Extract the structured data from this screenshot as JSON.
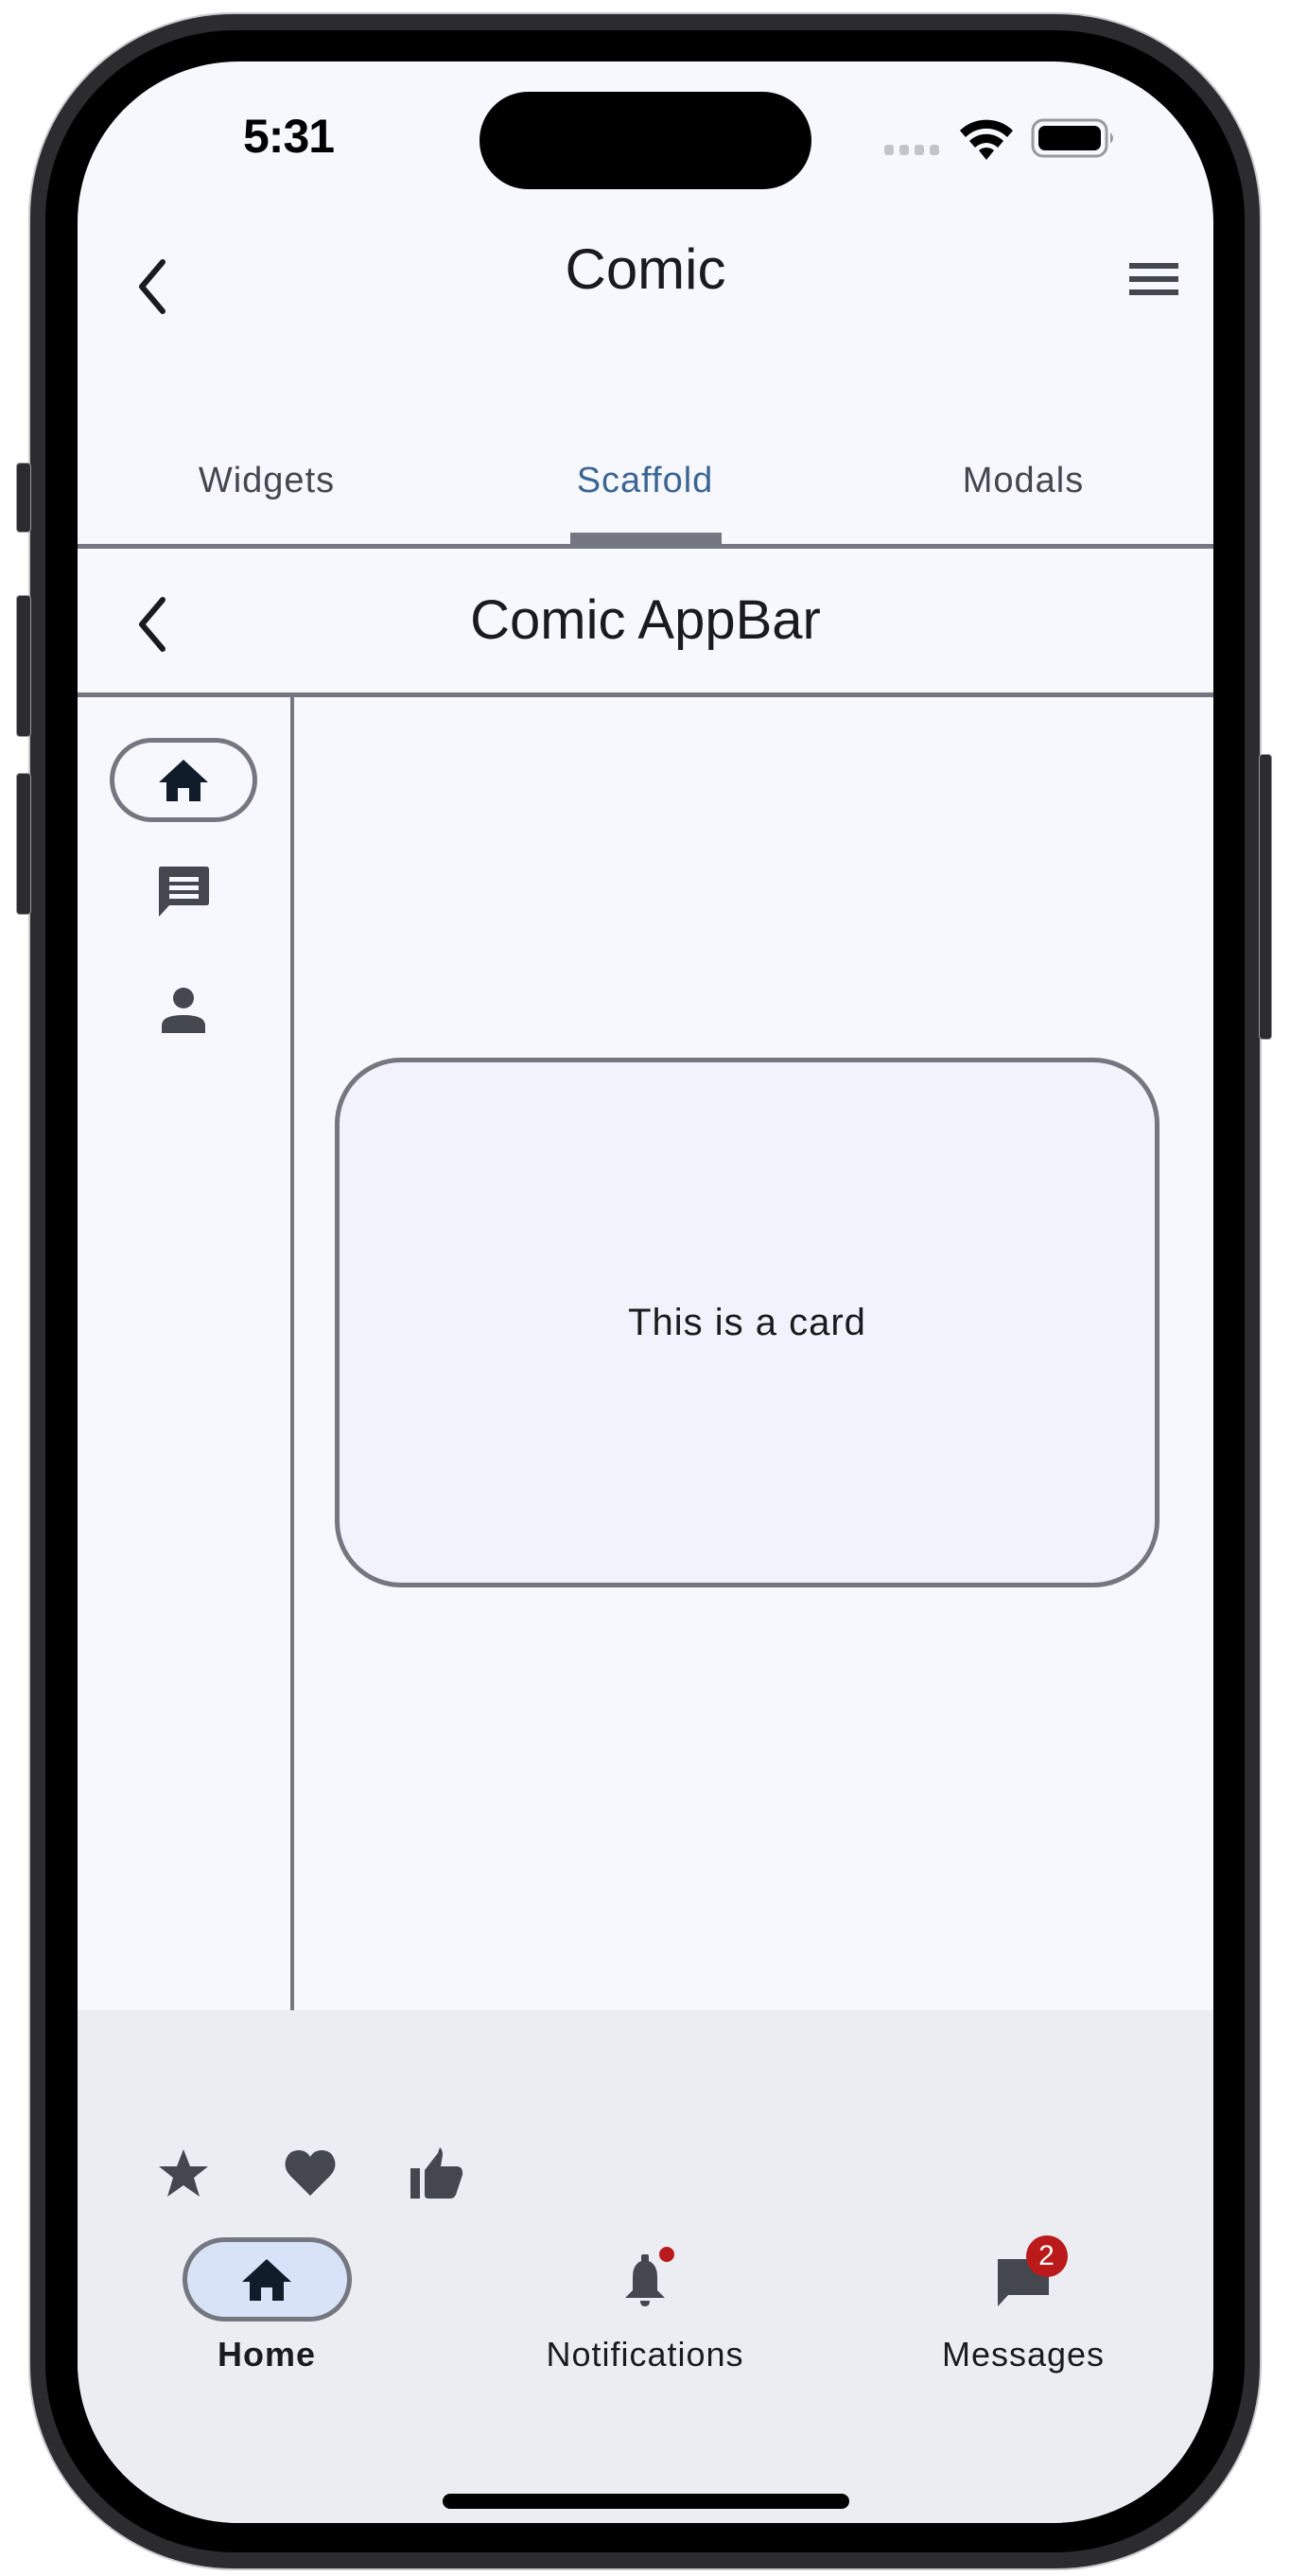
{
  "status_bar": {
    "time": "5:31",
    "icons": [
      "signal-dots-icon",
      "wifi-icon",
      "battery-icon"
    ]
  },
  "app_bar": {
    "title": "Comic",
    "back_icon": "chevron-left-icon",
    "menu_icon": "hamburger-menu-icon"
  },
  "tabs": [
    {
      "label": "Widgets",
      "active": false
    },
    {
      "label": "Scaffold",
      "active": true
    },
    {
      "label": "Modals",
      "active": false
    }
  ],
  "inner_app_bar": {
    "title": "Comic AppBar",
    "back_icon": "chevron-left-icon"
  },
  "navigation_rail": {
    "items": [
      {
        "icon": "home-icon",
        "active": true
      },
      {
        "icon": "chat-icon",
        "active": false
      },
      {
        "icon": "person-icon",
        "active": false
      }
    ]
  },
  "card": {
    "text": "This is a card"
  },
  "action_row": {
    "icons": [
      "star-icon",
      "heart-icon",
      "thumb-up-icon"
    ]
  },
  "bottom_nav": {
    "items": [
      {
        "label": "Home",
        "icon": "home-icon",
        "active": true
      },
      {
        "label": "Notifications",
        "icon": "bell-icon",
        "active": false,
        "badge": "dot"
      },
      {
        "label": "Messages",
        "icon": "message-icon",
        "active": false,
        "badge": "2"
      }
    ]
  },
  "colors": {
    "accent": "#3b6593",
    "outline": "#74777f",
    "background": "#f7f8fd",
    "card": "#f1f2fb",
    "bottom_bar": "#ecedf3",
    "nav_active": "#d8e3f7",
    "badge": "#ba1a1a",
    "icon": "#44474e",
    "icon_active": "#111c2b"
  }
}
